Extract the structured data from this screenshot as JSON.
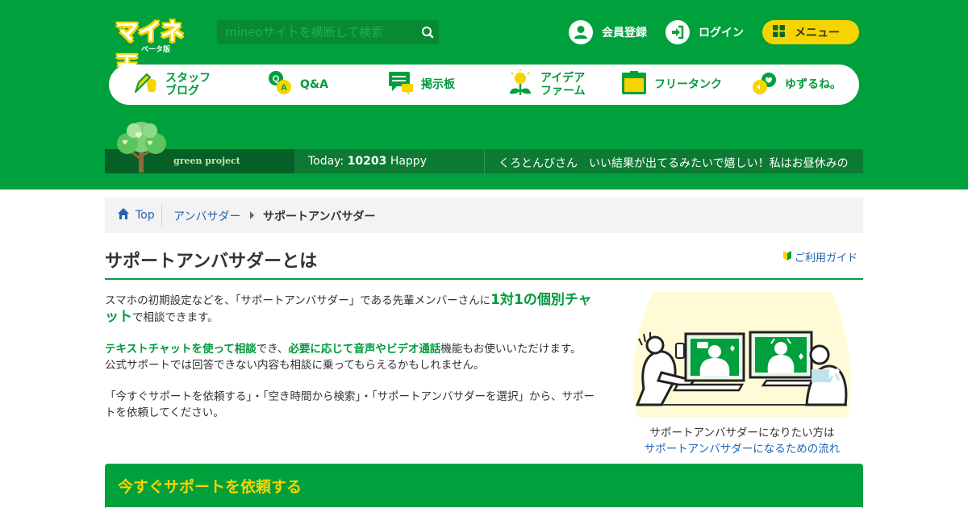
{
  "header": {
    "logo_main": "マイネ王",
    "logo_sub": "ベータ版",
    "search": {
      "placeholder": "mineoサイトを横断して検索"
    },
    "register_label": "会員登録",
    "login_label": "ログイン",
    "menu_label": "メニュー"
  },
  "nav": {
    "items": [
      {
        "label": "スタッフ ブログ",
        "line1": "スタッフ",
        "line2": "ブログ",
        "icon": "pen-icon"
      },
      {
        "label": "Q&A",
        "icon": "qa-icon"
      },
      {
        "label": "掲示板",
        "icon": "chat-board-icon"
      },
      {
        "label": "アイデア ファーム",
        "line1": "アイデア",
        "line2": "ファーム",
        "icon": "lightbulb-sprout-icon"
      },
      {
        "label": "フリータンク",
        "icon": "tank-icon"
      },
      {
        "label": "ゆずるね。",
        "icon": "yuzurune-icon"
      }
    ]
  },
  "green_project": {
    "name": "green project",
    "today_label": "Today:",
    "today_count": "10203",
    "today_suffix": "Happy",
    "ticker": "くろとんびさん　いい結果が出てるみたいで嬉しい！私はお昼休みの"
  },
  "breadcrumb": {
    "home": "Top",
    "parent": "アンバサダー",
    "current": "サポートアンバサダー"
  },
  "main": {
    "title": "サポートアンバサダーとは",
    "guide_link": "ご利用ガイド",
    "intro": {
      "p1_a": "スマホの初期設定などを、「サポートアンバサダー」である先輩メンバーさんに",
      "p1_hl": "1対1の個別チャット",
      "p1_b": "で相談できます。",
      "p2_hl1": "テキストチャットを使って相談",
      "p2_a": "でき、",
      "p2_hl2": "必要に応じて音声やビデオ通話",
      "p2_b": "機能もお使いいただけます。",
      "p2_c": "公式サポートでは回答できない内容も相談に乗ってもらえるかもしれません。",
      "p3": "「今すぐサポートを依頼する」・「空き時間から検索」・「サポートアンバサダーを選択」から、サポートを依頼してください。"
    },
    "ambassador_cta": {
      "text": "サポートアンバサダーになりたい方は",
      "link": "サポートアンバサダーになるための流れ"
    },
    "request_section": {
      "title": "今すぐサポートを依頼する"
    }
  },
  "colors": {
    "brand_green": "#00a03c",
    "accent_yellow": "#f6d400",
    "link_blue": "#1e63b5"
  }
}
